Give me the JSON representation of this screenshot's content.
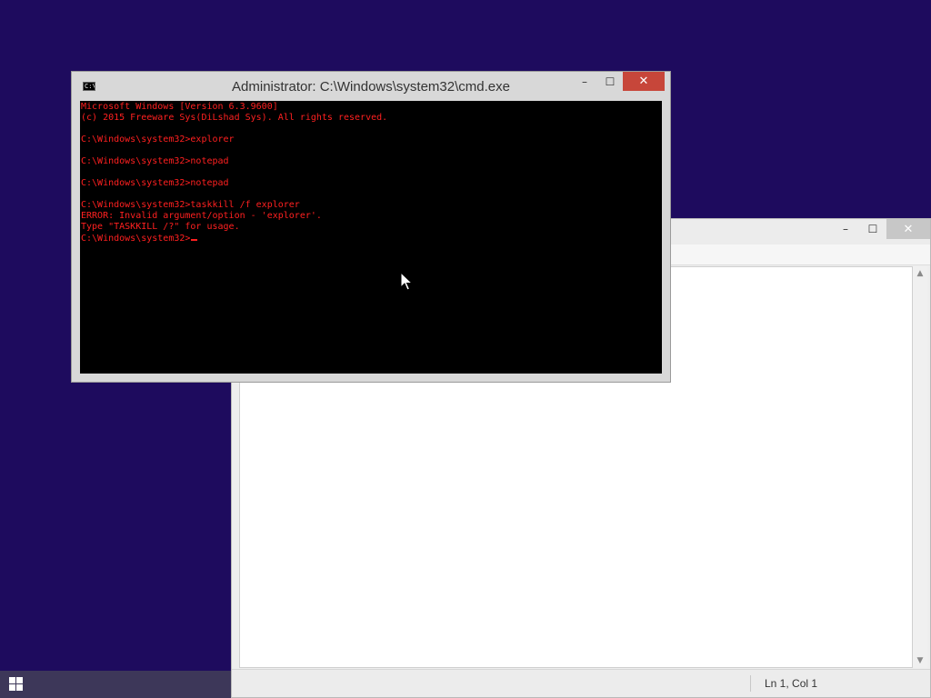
{
  "desktop": {
    "background": "#1e0b5e"
  },
  "cmd_window": {
    "title": "Administrator: C:\\Windows\\system32\\cmd.exe",
    "icon_text": "C:\\",
    "controls": {
      "minimize": "–",
      "maximize": "☐",
      "close": "✕"
    },
    "text_color": "#ff2020",
    "console_lines": [
      "Microsoft Windows [Version 6.3.9600]",
      "(c) 2015 Freeware Sys(DiLshad Sys). All rights reserved.",
      "",
      "C:\\Windows\\system32>explorer",
      "",
      "C:\\Windows\\system32>notepad",
      "",
      "C:\\Windows\\system32>notepad",
      "",
      "C:\\Windows\\system32>taskkill /f explorer",
      "ERROR: Invalid argument/option - 'explorer'.",
      "Type \"TASKKILL /?\" for usage.",
      ""
    ],
    "prompt": "C:\\Windows\\system32>"
  },
  "notepad_window": {
    "controls": {
      "minimize": "–",
      "maximize": "☐",
      "close": "✕"
    },
    "status": {
      "position": "Ln 1, Col 1"
    },
    "scroll_up": "▲",
    "scroll_down": "▼"
  },
  "taskbar": {
    "start_icon": "windows-logo-icon"
  }
}
